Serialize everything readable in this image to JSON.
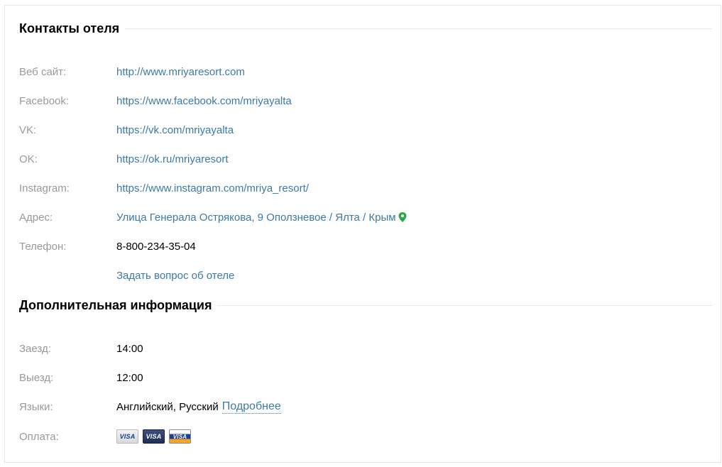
{
  "contacts": {
    "title": "Контакты отеля",
    "rows": [
      {
        "label": "Веб сайт:",
        "value": "http://www.mriyaresort.com"
      },
      {
        "label": "Facebook:",
        "value": "https://www.facebook.com/mriyayalta"
      },
      {
        "label": "VK:",
        "value": "https://vk.com/mriyayalta"
      },
      {
        "label": "OK:",
        "value": "https://ok.ru/mriyaresort"
      },
      {
        "label": "Instagram:",
        "value": "https://www.instagram.com/mriya_resort/"
      },
      {
        "label": "Адрес:",
        "value": "Улица Генерала Острякова, 9 Оползневое / Ялта / Крым",
        "icon": "map-pin-icon"
      },
      {
        "label": "Телефон:",
        "value": "8-800-234-35-04"
      }
    ],
    "ask_link": "Задать вопрос об отеле"
  },
  "extra": {
    "title": "Дополнительная информация",
    "checkin": {
      "label": "Заезд:",
      "value": "14:00"
    },
    "checkout": {
      "label": "Выезд:",
      "value": "12:00"
    },
    "languages": {
      "label": "Языки:",
      "value": "Английский, Русский",
      "more_link": "Подробнее"
    },
    "payment": {
      "label": "Оплата:",
      "cards": [
        {
          "name": "visa-card-icon",
          "text": "VISA"
        },
        {
          "name": "visa-electron-card-icon",
          "text": "VISA"
        },
        {
          "name": "visa-gold-card-icon",
          "text": "VISA"
        }
      ]
    }
  },
  "colors": {
    "link": "#3b7aa6",
    "label": "#999999",
    "pin": "#2ba84a",
    "rule": "#e8e8e8"
  }
}
